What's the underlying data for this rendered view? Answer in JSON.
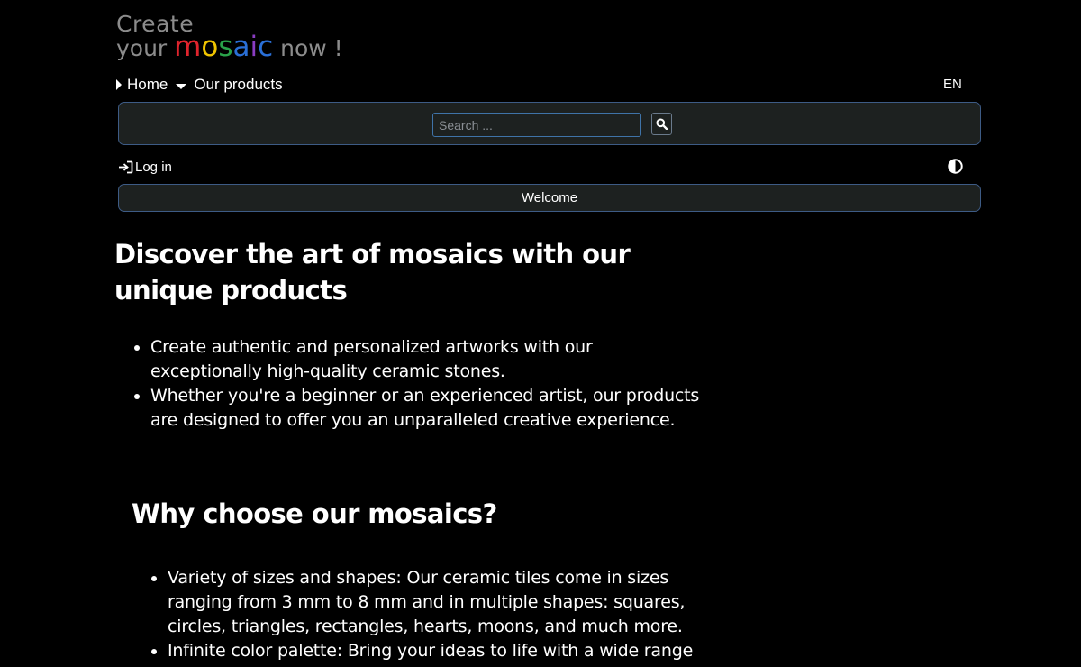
{
  "logo": {
    "line1": "Create",
    "line2_prefix": "your",
    "word_letters": [
      {
        "char": "m",
        "color": "#e0242d"
      },
      {
        "char": "o",
        "color": "#f0c400"
      },
      {
        "char": "s",
        "color": "#2aa34a"
      },
      {
        "char": "a",
        "color": "#2a6fd6"
      },
      {
        "char": "i",
        "color": "#8a3dc2"
      },
      {
        "char": "c",
        "color": "#2a6fd6"
      }
    ],
    "line2_suffix": "now !"
  },
  "nav": {
    "home": "Home",
    "products": "Our products",
    "language": "EN"
  },
  "search": {
    "placeholder": "Search ...",
    "icon": "search-icon"
  },
  "account": {
    "login_label": "Log in",
    "login_icon": "sign-in-icon",
    "contrast_icon": "contrast-icon"
  },
  "welcome": {
    "label": "Welcome"
  },
  "main": {
    "title": "Discover the art of mosaics with our unique products",
    "intro_items": [
      "Create authentic and personalized artworks with our exceptionally high-quality ceramic stones.",
      "Whether you're a beginner or an experienced artist, our products are designed to offer you an unparalleled creative experience."
    ],
    "section_title": "Why choose our mosaics?",
    "why_items": [
      "Variety of sizes and shapes: Our ceramic tiles come in sizes ranging from 3 mm to 8 mm and in multiple shapes: squares, circles, triangles, rectangles, hearts, moons, and much more.",
      "Infinite color palette: Bring your ideas to life with a wide range of vibrant and durable colors, carefully designed to stand the"
    ]
  },
  "colors": {
    "background": "#000000",
    "panel": "#1d2120",
    "panel_border": "#3d5b85",
    "logo_gray": "#8c8c8c"
  }
}
